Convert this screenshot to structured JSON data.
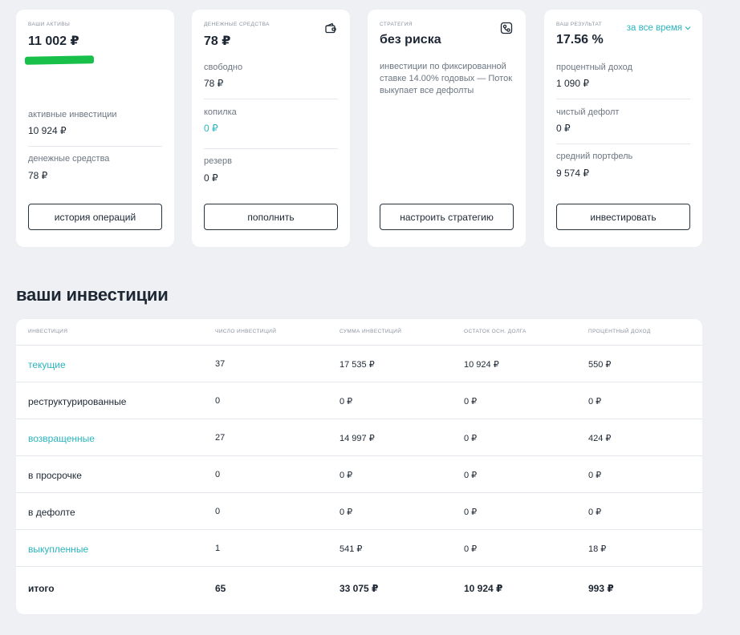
{
  "cards": {
    "assets": {
      "label": "ваши активы",
      "value": "11 002 ₽",
      "active_label": "активные инвестиции",
      "active_value": "10 924 ₽",
      "cash_label": "денежные средства",
      "cash_value": "78 ₽",
      "button": "история операций"
    },
    "cash": {
      "label": "денежные средства",
      "value": "78 ₽",
      "icon": "wallet-icon",
      "free_label": "свободно",
      "free_value": "78 ₽",
      "piggy_label": "копилка",
      "piggy_value": "0 ₽",
      "reserve_label": "резерв",
      "reserve_value": "0 ₽",
      "button": "пополнить"
    },
    "strategy": {
      "label": "стратегия",
      "value": "без риска",
      "icon": "strategy-icon",
      "description": "инвестиции по фиксированной ставке 14.00% годовых — Поток выкупает все дефолты",
      "button": "настроить стратегию"
    },
    "result": {
      "label": "ваш результат",
      "value": "17.56 %",
      "period": "за все время",
      "interest_label": "процентный доход",
      "interest_value": "1 090 ₽",
      "default_label": "чистый дефолт",
      "default_value": "0 ₽",
      "portfolio_label": "средний портфель",
      "portfolio_value": "9 574 ₽",
      "button": "инвестировать"
    }
  },
  "investments": {
    "title": "ваши инвестиции",
    "columns": [
      "инвестиция",
      "число инвестиций",
      "сумма инвестиций",
      "остаток осн. долга",
      "процентный доход"
    ],
    "rows": [
      {
        "name": "текущие",
        "link": true,
        "count": "37",
        "sum": "17 535 ₽",
        "principal": "10 924 ₽",
        "interest": "550 ₽"
      },
      {
        "name": "реструктурированные",
        "link": false,
        "count": "0",
        "sum": "0 ₽",
        "principal": "0 ₽",
        "interest": "0 ₽"
      },
      {
        "name": "возвращенные",
        "link": true,
        "count": "27",
        "sum": "14 997 ₽",
        "principal": "0 ₽",
        "interest": "424 ₽"
      },
      {
        "name": "в просрочке",
        "link": false,
        "count": "0",
        "sum": "0 ₽",
        "principal": "0 ₽",
        "interest": "0 ₽"
      },
      {
        "name": "в дефолте",
        "link": false,
        "count": "0",
        "sum": "0 ₽",
        "principal": "0 ₽",
        "interest": "0 ₽"
      },
      {
        "name": "выкупленные",
        "link": true,
        "count": "1",
        "sum": "541 ₽",
        "principal": "0 ₽",
        "interest": "18 ₽"
      }
    ],
    "total": {
      "name": "итого",
      "count": "65",
      "sum": "33 075 ₽",
      "principal": "10 924 ₽",
      "interest": "993 ₽"
    }
  },
  "colors": {
    "accent": "#2bb5bd",
    "text": "#1d2733",
    "muted": "#8a94a0",
    "background": "#eef0f3"
  }
}
